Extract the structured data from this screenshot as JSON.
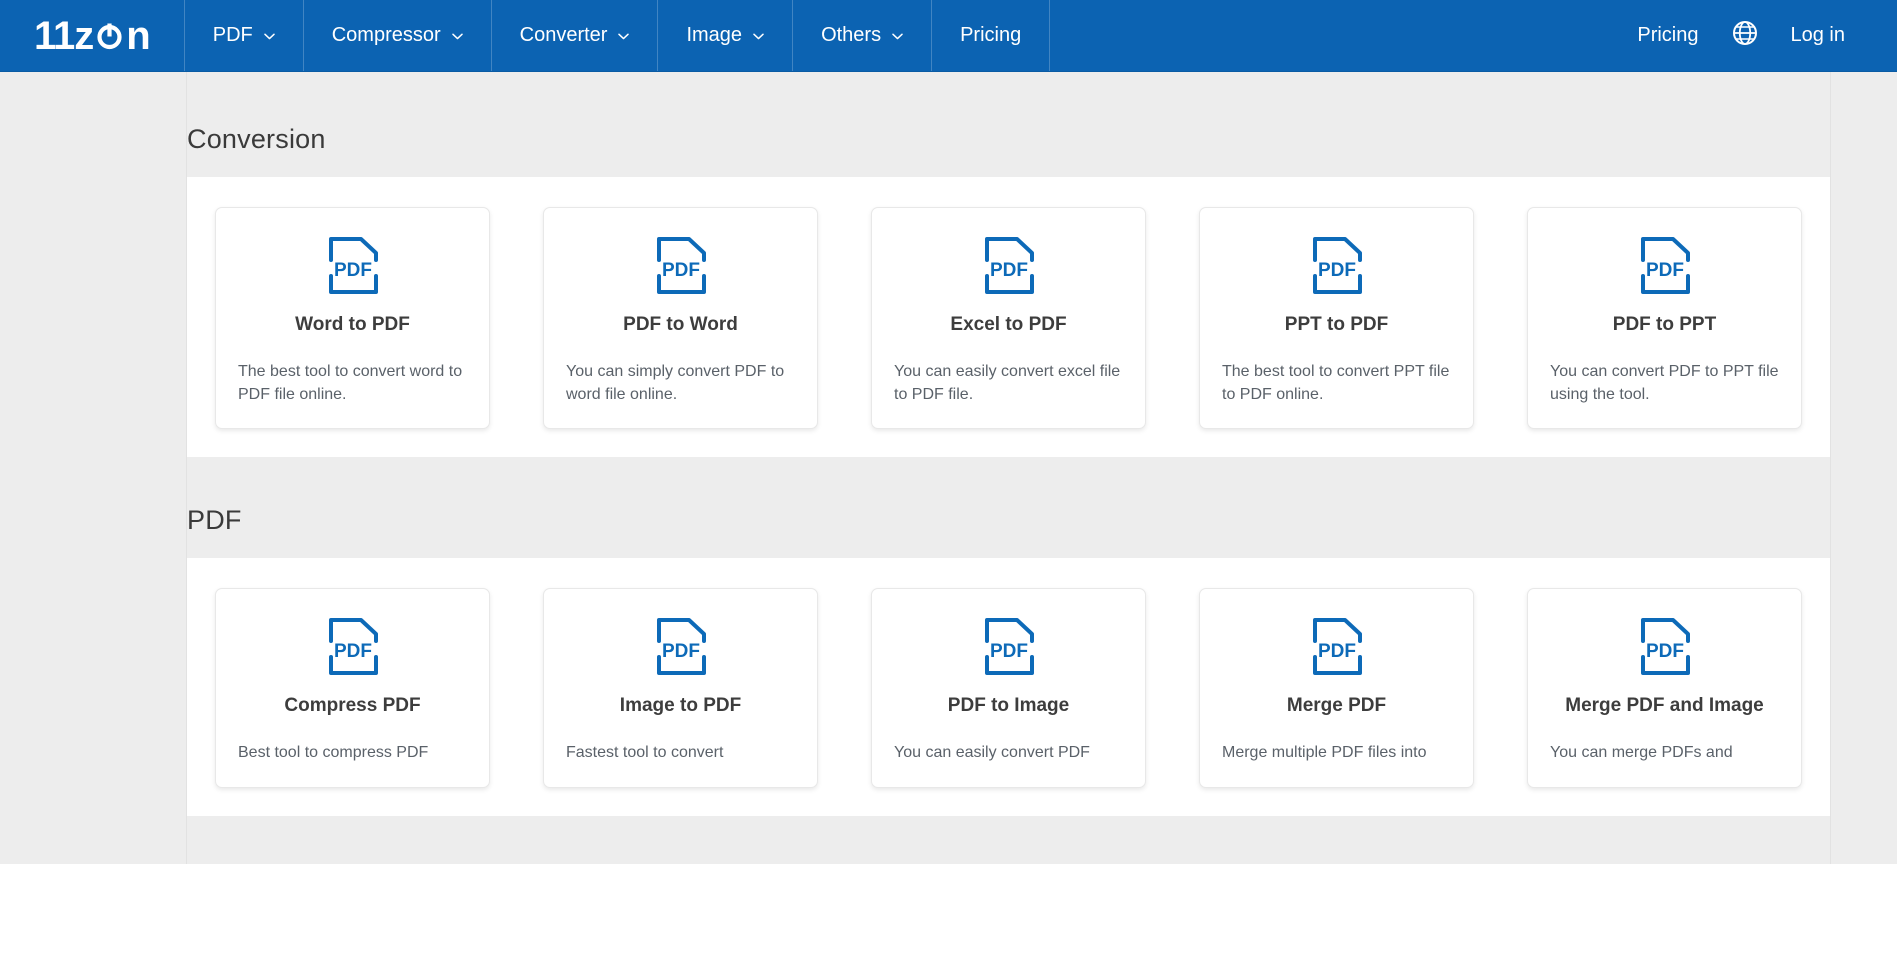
{
  "navbar": {
    "logo": {
      "text_before": "11z",
      "text_after": "n",
      "icon": "power-o-icon"
    },
    "items": [
      {
        "label": "PDF",
        "has_caret": true
      },
      {
        "label": "Compressor",
        "has_caret": true
      },
      {
        "label": "Converter",
        "has_caret": true
      },
      {
        "label": "Image",
        "has_caret": true
      },
      {
        "label": "Others",
        "has_caret": true
      },
      {
        "label": "Pricing",
        "has_caret": false
      }
    ],
    "right": {
      "pricing": "Pricing",
      "globe_icon": "globe-icon",
      "login": "Log in"
    },
    "background_color": "#0c63b2"
  },
  "sections": [
    {
      "title": "Conversion",
      "cards": [
        {
          "icon": "pdf-file-icon",
          "title": "Word to PDF",
          "desc": "The best tool to convert word to PDF file online."
        },
        {
          "icon": "pdf-file-icon",
          "title": "PDF to Word",
          "desc": "You can simply convert PDF to word file online."
        },
        {
          "icon": "pdf-file-icon",
          "title": "Excel to PDF",
          "desc": "You can easily convert excel file to PDF file."
        },
        {
          "icon": "pdf-file-icon",
          "title": "PPT to PDF",
          "desc": "The best tool to convert PPT file to PDF online."
        },
        {
          "icon": "pdf-file-icon",
          "title": "PDF to PPT",
          "desc": "You can convert PDF to PPT file using the tool."
        }
      ]
    },
    {
      "title": "PDF",
      "cards": [
        {
          "icon": "pdf-file-icon",
          "title": "Compress PDF",
          "desc": "Best tool to compress PDF"
        },
        {
          "icon": "pdf-file-icon",
          "title": "Image to PDF",
          "desc": "Fastest tool to convert"
        },
        {
          "icon": "pdf-file-icon",
          "title": "PDF to Image",
          "desc": "You can easily convert PDF"
        },
        {
          "icon": "pdf-file-icon",
          "title": "Merge PDF",
          "desc": "Merge multiple PDF files into"
        },
        {
          "icon": "pdf-file-icon",
          "title": "Merge PDF and Image",
          "desc": "You can merge PDFs and"
        }
      ]
    }
  ],
  "colors": {
    "brand_blue": "#0c63b2",
    "icon_blue": "#0d6ab8",
    "page_bg": "#ededed",
    "card_bg": "#ffffff",
    "title_text": "#3d3d3d",
    "desc_text": "#5a6169"
  }
}
